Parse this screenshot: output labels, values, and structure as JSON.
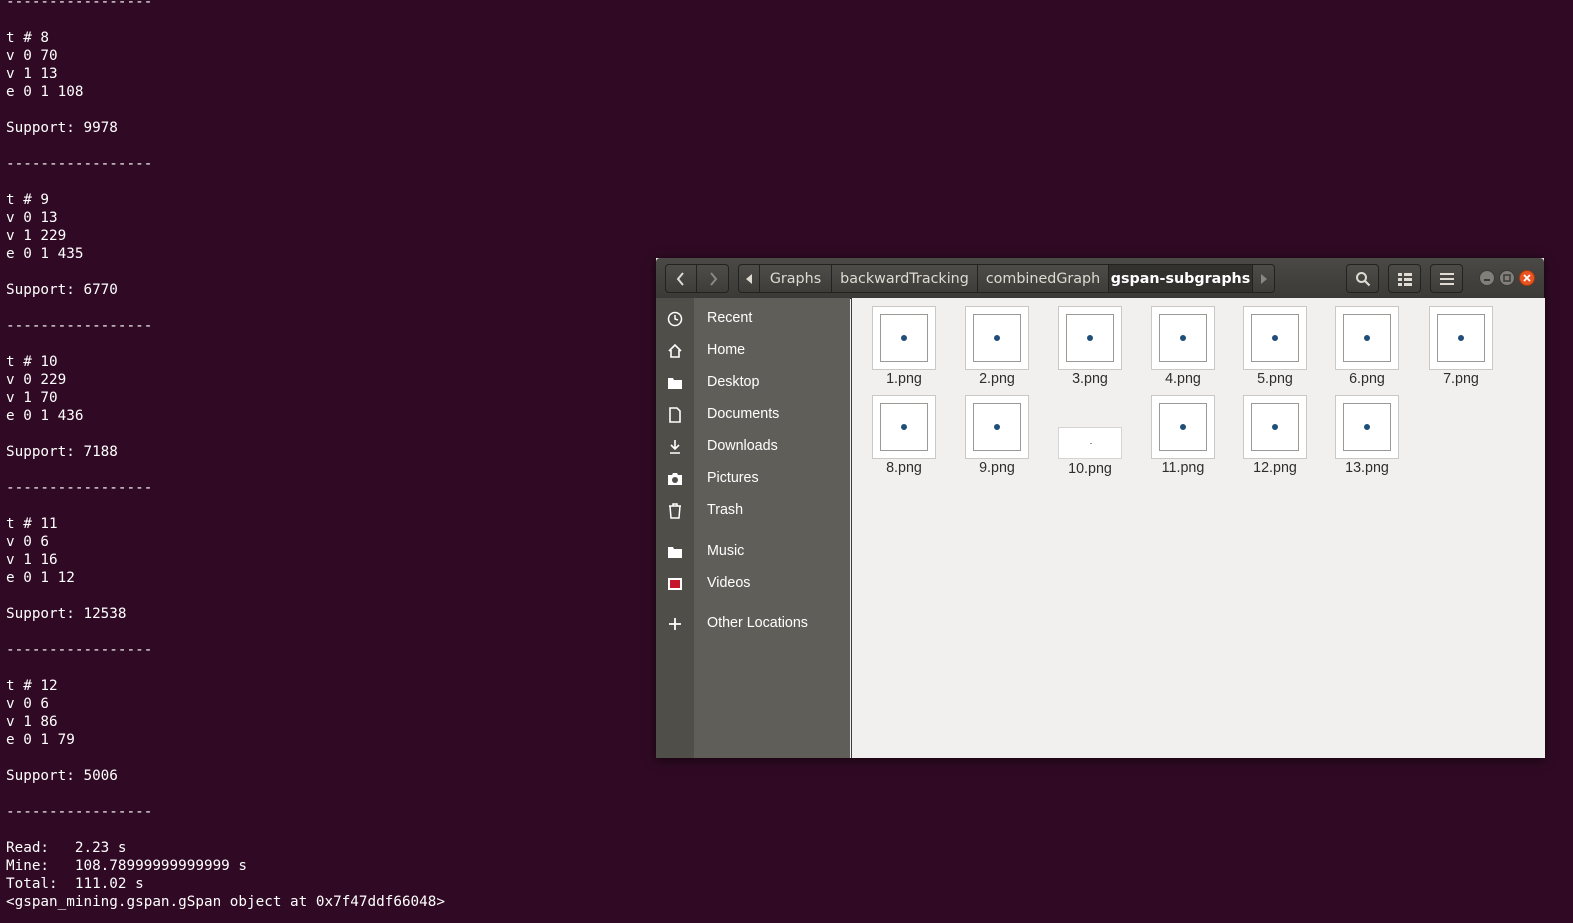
{
  "terminal": {
    "lines": [
      "-----------------",
      "",
      "t # 8",
      "v 0 70",
      "v 1 13",
      "e 0 1 108",
      "",
      "Support: 9978",
      "",
      "-----------------",
      "",
      "t # 9",
      "v 0 13",
      "v 1 229",
      "e 0 1 435",
      "",
      "Support: 6770",
      "",
      "-----------------",
      "",
      "t # 10",
      "v 0 229",
      "v 1 70",
      "e 0 1 436",
      "",
      "Support: 7188",
      "",
      "-----------------",
      "",
      "t # 11",
      "v 0 6",
      "v 1 16",
      "e 0 1 12",
      "",
      "Support: 12538",
      "",
      "-----------------",
      "",
      "t # 12",
      "v 0 6",
      "v 1 86",
      "e 0 1 79",
      "",
      "Support: 5006",
      "",
      "-----------------",
      "",
      "Read:   2.23 s",
      "Mine:   108.78999999999999 s",
      "Total:  111.02 s",
      "<gspan_mining.gspan.gSpan object at 0x7f47ddf66048>"
    ]
  },
  "file_manager": {
    "breadcrumbs": [
      "Graphs",
      "backwardTracking",
      "combinedGraph",
      "gspan-subgraphs"
    ],
    "active_crumb": "gspan-subgraphs",
    "sidebar": [
      {
        "label": "Recent",
        "icon": "clock-icon"
      },
      {
        "label": "Home",
        "icon": "home-icon"
      },
      {
        "label": "Desktop",
        "icon": "folder-icon"
      },
      {
        "label": "Documents",
        "icon": "document-icon"
      },
      {
        "label": "Downloads",
        "icon": "download-icon"
      },
      {
        "label": "Pictures",
        "icon": "camera-icon"
      },
      {
        "label": "Trash",
        "icon": "trash-icon"
      },
      {
        "label": "Music",
        "icon": "folder-icon"
      },
      {
        "label": "Videos",
        "icon": "video-icon"
      },
      {
        "label": "Other Locations",
        "icon": "plus-icon"
      }
    ],
    "files": [
      "1.png",
      "2.png",
      "3.png",
      "4.png",
      "5.png",
      "6.png",
      "7.png",
      "8.png",
      "9.png",
      "10.png",
      "11.png",
      "12.png",
      "13.png"
    ],
    "colors": {
      "terminal_bg": "#300a24",
      "close_button": "#e95420",
      "dot": "#1f4e79"
    }
  }
}
